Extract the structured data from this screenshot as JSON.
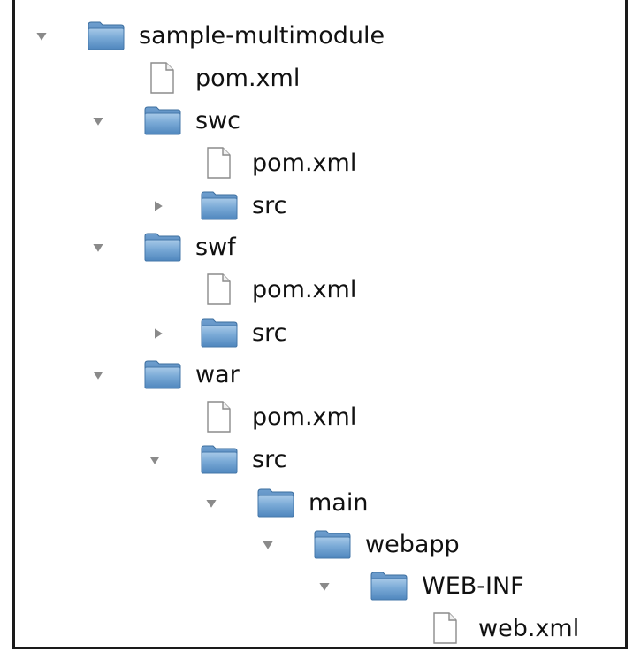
{
  "tree": {
    "root": {
      "label": "sample-multimodule",
      "expanded": true,
      "icon": "folder-icon",
      "children": {
        "pom": {
          "label": "pom.xml",
          "icon": "file-icon"
        },
        "swc": {
          "label": "swc",
          "expanded": true,
          "icon": "folder-icon",
          "children": {
            "pom": {
              "label": "pom.xml",
              "icon": "file-icon"
            },
            "src": {
              "label": "src",
              "expanded": false,
              "icon": "folder-icon"
            }
          }
        },
        "swf": {
          "label": "swf",
          "expanded": true,
          "icon": "folder-icon",
          "children": {
            "pom": {
              "label": "pom.xml",
              "icon": "file-icon"
            },
            "src": {
              "label": "src",
              "expanded": false,
              "icon": "folder-icon"
            }
          }
        },
        "war": {
          "label": "war",
          "expanded": true,
          "icon": "folder-icon",
          "children": {
            "pom": {
              "label": "pom.xml",
              "icon": "file-icon"
            },
            "src": {
              "label": "src",
              "expanded": true,
              "icon": "folder-icon",
              "children": {
                "main": {
                  "label": "main",
                  "expanded": true,
                  "icon": "folder-icon",
                  "children": {
                    "webapp": {
                      "label": "webapp",
                      "expanded": true,
                      "icon": "folder-icon",
                      "children": {
                        "webinf": {
                          "label": "WEB-INF",
                          "expanded": true,
                          "icon": "folder-icon",
                          "children": {
                            "webxml": {
                              "label": "web.xml",
                              "icon": "file-icon"
                            }
                          }
                        }
                      }
                    }
                  }
                }
              }
            }
          }
        }
      }
    }
  },
  "colors": {
    "folder_front": "#6a9ccf",
    "folder_back": "#4a7fb5",
    "twisty": "#8a8a8a",
    "file_stroke": "#9a9a9a"
  }
}
